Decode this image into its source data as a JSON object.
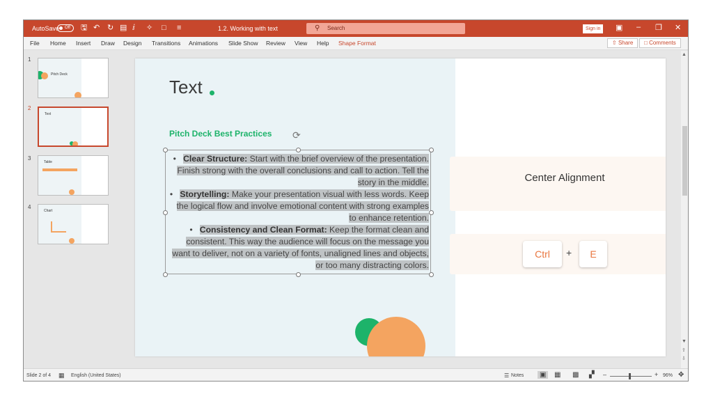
{
  "titlebar": {
    "autosave_label": "AutoSave",
    "autosave_state": "Off",
    "doc_title": "1.2. Working with text",
    "search_placeholder": "Search",
    "sign_in": "Sign in"
  },
  "menu": {
    "items": [
      "File",
      "Home",
      "Insert",
      "Draw",
      "Design",
      "Transitions",
      "Animations",
      "Slide Show",
      "Review",
      "View",
      "Help",
      "Shape Format"
    ],
    "share": "Share",
    "comments": "Comments"
  },
  "thumbnails": [
    {
      "num": "1",
      "title": "Pitch Deck"
    },
    {
      "num": "2",
      "title": "Text"
    },
    {
      "num": "3",
      "title": "Table"
    },
    {
      "num": "4",
      "title": "Chart"
    }
  ],
  "slide": {
    "title": "Text",
    "subheading": "Pitch Deck Best Practices",
    "bullets": [
      {
        "bold": "Clear Structure:",
        "text": " Start with the brief overview of the presentation. Finish strong with the overall conclusions and call to action. Tell the story in the middle."
      },
      {
        "bold": "Storytelling:",
        "text": " Make your presentation visual with less words. Keep the logical flow and involve emotional content with strong examples to enhance retention."
      },
      {
        "bold": "Consistency and Clean Format:",
        "text": " Keep the format clean and consistent. This way the audience will focus on the message you want to deliver, not on a variety of fonts, unaligned lines and objects, or too many distracting colors."
      }
    ],
    "card_label": "Center Alignment",
    "key1": "Ctrl",
    "plus": "+",
    "key2": "E"
  },
  "statusbar": {
    "slide_info": "Slide 2 of 4",
    "language": "English (United States)",
    "notes": "Notes",
    "zoom": "96%"
  },
  "colors": {
    "accent": "#c7472c",
    "green": "#1db36a",
    "orange": "#f4a460"
  }
}
